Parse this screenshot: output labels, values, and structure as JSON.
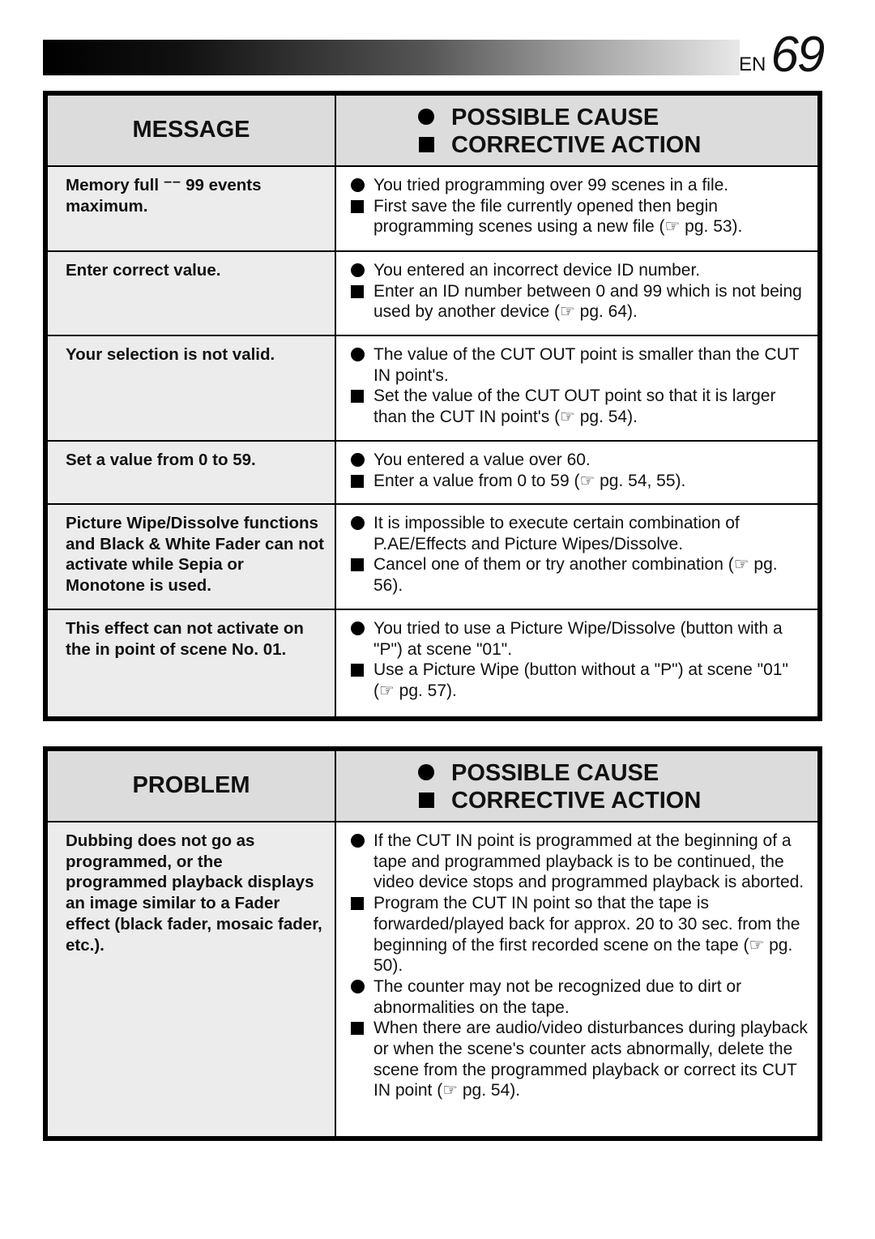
{
  "page": {
    "lang": "EN",
    "number": "69"
  },
  "message_table": {
    "header_left": "MESSAGE",
    "header_cause": "POSSIBLE CAUSE",
    "header_action": "CORRECTIVE ACTION",
    "rows": [
      {
        "message": "Memory full ⁻⁻ 99 events maximum.",
        "items": [
          {
            "type": "cause",
            "text": "You tried programming over 99 scenes in a file."
          },
          {
            "type": "action",
            "text": "First save the file currently opened then begin programming scenes using a new file (☞ pg. 53)."
          }
        ]
      },
      {
        "message": "Enter correct value.",
        "items": [
          {
            "type": "cause",
            "text": "You entered an incorrect device ID number."
          },
          {
            "type": "action",
            "text": "Enter an ID number between 0 and 99 which is not being used by another device (☞ pg. 64)."
          }
        ]
      },
      {
        "message": "Your selection is not valid.",
        "items": [
          {
            "type": "cause",
            "text": "The value of the CUT OUT point is smaller than the CUT IN point's."
          },
          {
            "type": "action",
            "text": "Set the value of the CUT OUT point so that it is larger than the CUT IN point's (☞ pg. 54)."
          }
        ]
      },
      {
        "message": "Set a value from 0 to 59.",
        "items": [
          {
            "type": "cause",
            "text": "You entered a value over 60."
          },
          {
            "type": "action",
            "text": "Enter a value from 0 to 59 (☞ pg. 54, 55)."
          }
        ]
      },
      {
        "message": "Picture Wipe/Dissolve functions and Black & White Fader can not activate while Sepia or Monotone is used.",
        "items": [
          {
            "type": "cause",
            "text": "It is impossible to execute certain combination of P.AE/Effects and Picture Wipes/Dissolve."
          },
          {
            "type": "action",
            "text": "Cancel one of them or try another combination (☞ pg. 56)."
          }
        ]
      },
      {
        "message": "This effect can not activate on the in point of scene No. 01.",
        "items": [
          {
            "type": "cause",
            "text": "You tried to use a Picture Wipe/Dissolve (button with a \"P\") at scene \"01\"."
          },
          {
            "type": "action",
            "text": "Use a Picture Wipe (button without a \"P\") at scene \"01\" (☞ pg. 57)."
          }
        ]
      }
    ]
  },
  "problem_table": {
    "header_left": "PROBLEM",
    "header_cause": "POSSIBLE CAUSE",
    "header_action": "CORRECTIVE ACTION",
    "rows": [
      {
        "message": "Dubbing does not go as programmed, or the programmed playback displays an image similar to a Fader effect (black fader, mosaic fader, etc.).",
        "items": [
          {
            "type": "cause",
            "text": "If the CUT IN point is programmed at the beginning of a tape and programmed playback is to be continued, the video device stops and programmed playback is aborted."
          },
          {
            "type": "action",
            "text": "Program the CUT IN point so that the tape is forwarded/played back for approx. 20 to 30 sec. from the beginning of the first recorded scene on the tape (☞ pg. 50)."
          },
          {
            "type": "cause",
            "text": "The counter may not be recognized due to dirt or abnormalities on the tape."
          },
          {
            "type": "action",
            "text": "When there are audio/video disturbances during playback or when the scene's counter acts abnormally, delete the scene from the programmed playback or correct its CUT IN point (☞ pg. 54)."
          }
        ]
      }
    ]
  }
}
